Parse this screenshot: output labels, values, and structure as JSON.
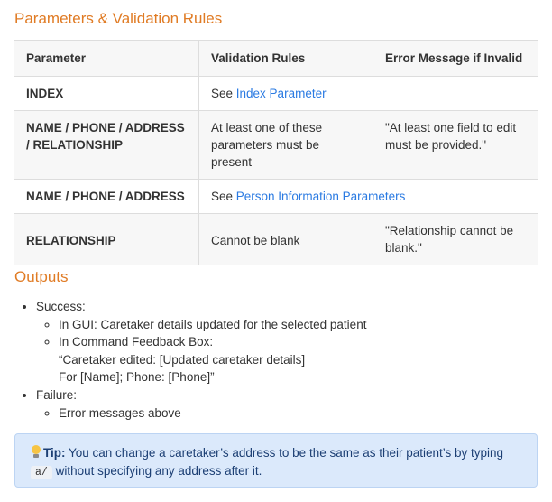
{
  "params_heading": "Parameters & Validation Rules",
  "table": {
    "headers": [
      "Parameter",
      "Validation Rules",
      "Error Message if Invalid"
    ],
    "rows": [
      {
        "param": "INDEX",
        "rule_prefix": "See ",
        "rule_link": "Index Parameter"
      },
      {
        "param": "NAME / PHONE / ADDRESS / RELATIONSHIP",
        "rule": "At least one of these parameters must be present",
        "error": "\"At least one field to edit must be provided.\""
      },
      {
        "param": "NAME / PHONE / ADDRESS",
        "rule_prefix": "See ",
        "rule_link": "Person Information Parameters"
      },
      {
        "param": "RELATIONSHIP",
        "rule": "Cannot be blank",
        "error": "\"Relationship cannot be blank.\""
      }
    ]
  },
  "outputs_heading": "Outputs",
  "outputs": {
    "success_label": "Success:",
    "success_gui": "In GUI: Caretaker details updated for the selected patient",
    "success_feedback_label": "In Command Feedback Box:",
    "success_feedback_line1": "“Caretaker edited: [Updated caretaker details]",
    "success_feedback_line2": "For [Name]; Phone: [Phone]”",
    "failure_label": "Failure:",
    "failure_detail": "Error messages above"
  },
  "tip": {
    "icon": "lightbulb-icon",
    "label": "Tip:",
    "text_before": " You can change a caretaker’s address to be the same as their patient’s by typing ",
    "code": "a/",
    "text_after": " without specifying any address after it."
  },
  "colors": {
    "heading": "#e07b24",
    "link": "#2a7ae2",
    "tip_background": "#dbe9fb",
    "tip_text": "#1c3f74"
  }
}
